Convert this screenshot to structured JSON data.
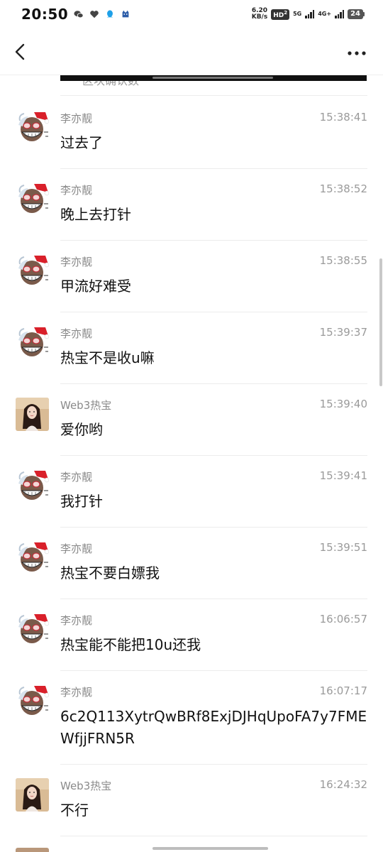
{
  "status_bar": {
    "time": "20:50",
    "net_speed_value": "6.20",
    "net_speed_unit": "KB/s",
    "hd_badge": "HD",
    "hd_sub": "2",
    "net_5g": "5G",
    "net_4g": "4G+",
    "battery": "24",
    "notification_icons": [
      "wechat-icon",
      "heart-icon",
      "qq-icon",
      "cat-icon"
    ]
  },
  "header": {
    "back_icon": "chevron-left-icon",
    "more_icon": "more-horizontal-icon"
  },
  "partial_top_message": {
    "text": "区块确认数"
  },
  "messages": [
    {
      "sender": "李亦靓",
      "time": "15:38:41",
      "text": "过去了",
      "avatar": "santa-clown"
    },
    {
      "sender": "李亦靓",
      "time": "15:38:52",
      "text": "晚上去打针",
      "avatar": "santa-clown"
    },
    {
      "sender": "李亦靓",
      "time": "15:38:55",
      "text": "甲流好难受",
      "avatar": "santa-clown"
    },
    {
      "sender": "李亦靓",
      "time": "15:39:37",
      "text": "热宝不是收u嘛",
      "avatar": "santa-clown"
    },
    {
      "sender": "Web3热宝",
      "time": "15:39:40",
      "text": "爱你哟",
      "avatar": "girl"
    },
    {
      "sender": "李亦靓",
      "time": "15:39:41",
      "text": "我打针",
      "avatar": "santa-clown"
    },
    {
      "sender": "李亦靓",
      "time": "15:39:51",
      "text": "热宝不要白嫖我",
      "avatar": "santa-clown"
    },
    {
      "sender": "李亦靓",
      "time": "16:06:57",
      "text": "热宝能不能把10u还我",
      "avatar": "santa-clown"
    },
    {
      "sender": "李亦靓",
      "time": "16:07:17",
      "text": "6c2Q113XytrQwBRf8ExjDJHqUpoFA7y7FMEWfjjFRN5R",
      "avatar": "santa-clown"
    },
    {
      "sender": "Web3热宝",
      "time": "16:24:32",
      "text": "不行",
      "avatar": "girl"
    }
  ],
  "colors": {
    "name": "#8a8a8a",
    "time": "#9a9a9a",
    "text": "#111111",
    "divider": "#ececec"
  }
}
